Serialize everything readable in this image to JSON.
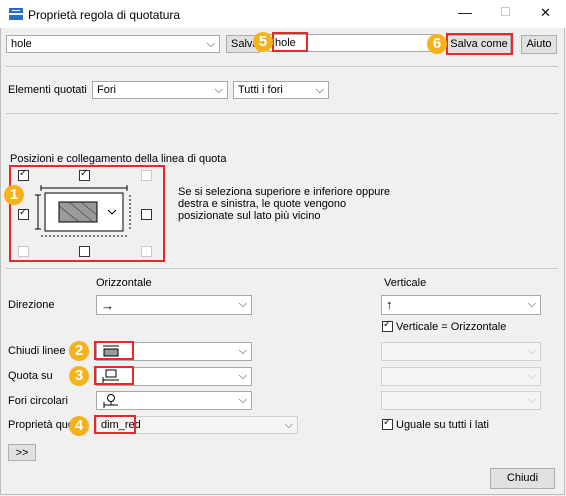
{
  "window": {
    "title": "Proprietà regola di quotatura",
    "minimize_glyph": "—",
    "maximize_glyph": "☐",
    "close_glyph": "✕"
  },
  "toolbar": {
    "rule_select_value": "hole",
    "save_label": "Salva",
    "name_value": "hole",
    "save_as_label": "Salva come",
    "help_label": "Aiuto"
  },
  "elements": {
    "label": "Elementi quotati",
    "type_value": "Fori",
    "filter_value": "Tutti i fori"
  },
  "positions": {
    "label": "Posizioni e collegamento della linea di quota",
    "description": "Se si seleziona superiore e inferiore oppure destra e sinistra, le quote vengono posizionate sul lato più vicino"
  },
  "columns": {
    "horizontal": "Orizzontale",
    "vertical": "Verticale"
  },
  "direction": {
    "label": "Direzione",
    "horizontal_value": "→",
    "vertical_value": "↑",
    "vertical_equals_label": "Verticale = Orizzontale",
    "vertical_equals_checked": true
  },
  "close_lines": {
    "label": "Chiudi linee"
  },
  "dimension_on": {
    "label": "Quota su"
  },
  "circular_holes": {
    "label": "Fori circolari"
  },
  "dimension_properties": {
    "label": "Proprietà quota",
    "value": "dim_red",
    "same_all_sides_label": "Uguale su tutti i lati",
    "same_all_sides_checked": true
  },
  "footer": {
    "expand_label": ">>",
    "close_label": "Chiudi"
  },
  "callouts": [
    "1",
    "2",
    "3",
    "4",
    "5",
    "6"
  ],
  "colors": {
    "callout_fill": "#f5b21c",
    "highlight_border": "#e8282d",
    "app_icon": "#2b6cc4"
  }
}
